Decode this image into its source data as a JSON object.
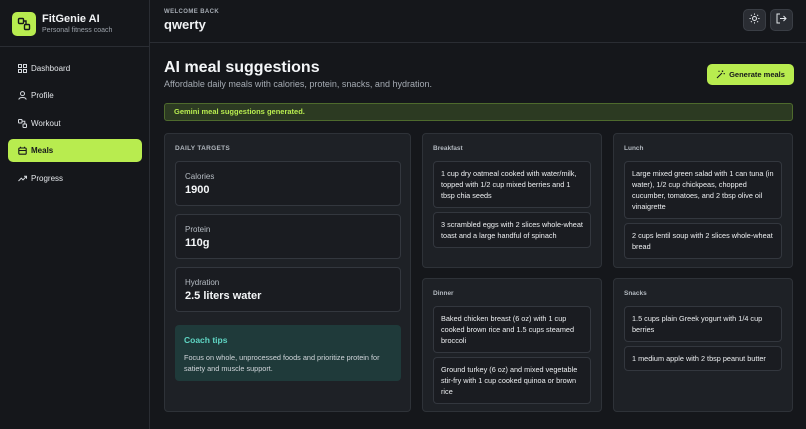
{
  "app": {
    "name": "FitGenie AI",
    "tagline": "Personal fitness coach"
  },
  "sidebar": {
    "items": [
      {
        "label": "Dashboard",
        "icon": "grid-icon"
      },
      {
        "label": "Profile",
        "icon": "user-icon"
      },
      {
        "label": "Workout",
        "icon": "workout-icon"
      },
      {
        "label": "Meals",
        "icon": "meal-icon",
        "active": true
      },
      {
        "label": "Progress",
        "icon": "trend-icon"
      }
    ]
  },
  "header": {
    "welcome": "WELCOME BACK",
    "username": "qwerty",
    "theme_icon": "sun-icon",
    "logout_icon": "logout-icon"
  },
  "page": {
    "title": "AI meal suggestions",
    "subtitle": "Affordable daily meals with calories, protein, snacks, and hydration.",
    "generate_label": "Generate meals",
    "alert": "Gemini meal suggestions generated."
  },
  "targets": {
    "label": "DAILY TARGETS",
    "calories": {
      "name": "Calories",
      "value": "1900"
    },
    "protein": {
      "name": "Protein",
      "value": "110g"
    },
    "hydration": {
      "name": "Hydration",
      "value": "2.5 liters water"
    },
    "tips_title": "Coach tips",
    "tips_text": "Focus on whole, unprocessed foods and prioritize protein for satiety and muscle support."
  },
  "meals": {
    "breakfast": {
      "title": "Breakfast",
      "items": [
        "1 cup dry oatmeal cooked with water/milk, topped with 1/2 cup mixed berries and 1 tbsp chia seeds",
        "3 scrambled eggs with 2 slices whole-wheat toast and a large handful of spinach"
      ]
    },
    "lunch": {
      "title": "Lunch",
      "items": [
        "Large mixed green salad with 1 can tuna (in water), 1/2 cup chickpeas, chopped cucumber, tomatoes, and 2 tbsp olive oil vinaigrette",
        "2 cups lentil soup with 2 slices whole-wheat bread"
      ]
    },
    "dinner": {
      "title": "Dinner",
      "items": [
        "Baked chicken breast (6 oz) with 1 cup cooked brown rice and 1.5 cups steamed broccoli",
        "Ground turkey (6 oz) and mixed vegetable stir-fry with 1 cup cooked quinoa or brown rice"
      ]
    },
    "snacks": {
      "title": "Snacks",
      "items": [
        "1.5 cups plain Greek yogurt with 1/4 cup berries",
        "1 medium apple with 2 tbsp peanut butter"
      ]
    }
  },
  "colors": {
    "accent": "#b8ec4f",
    "background": "#15171b",
    "card": "#1e2126",
    "tips_bg": "#1f3a3a",
    "tips_title": "#5fd6c4"
  }
}
